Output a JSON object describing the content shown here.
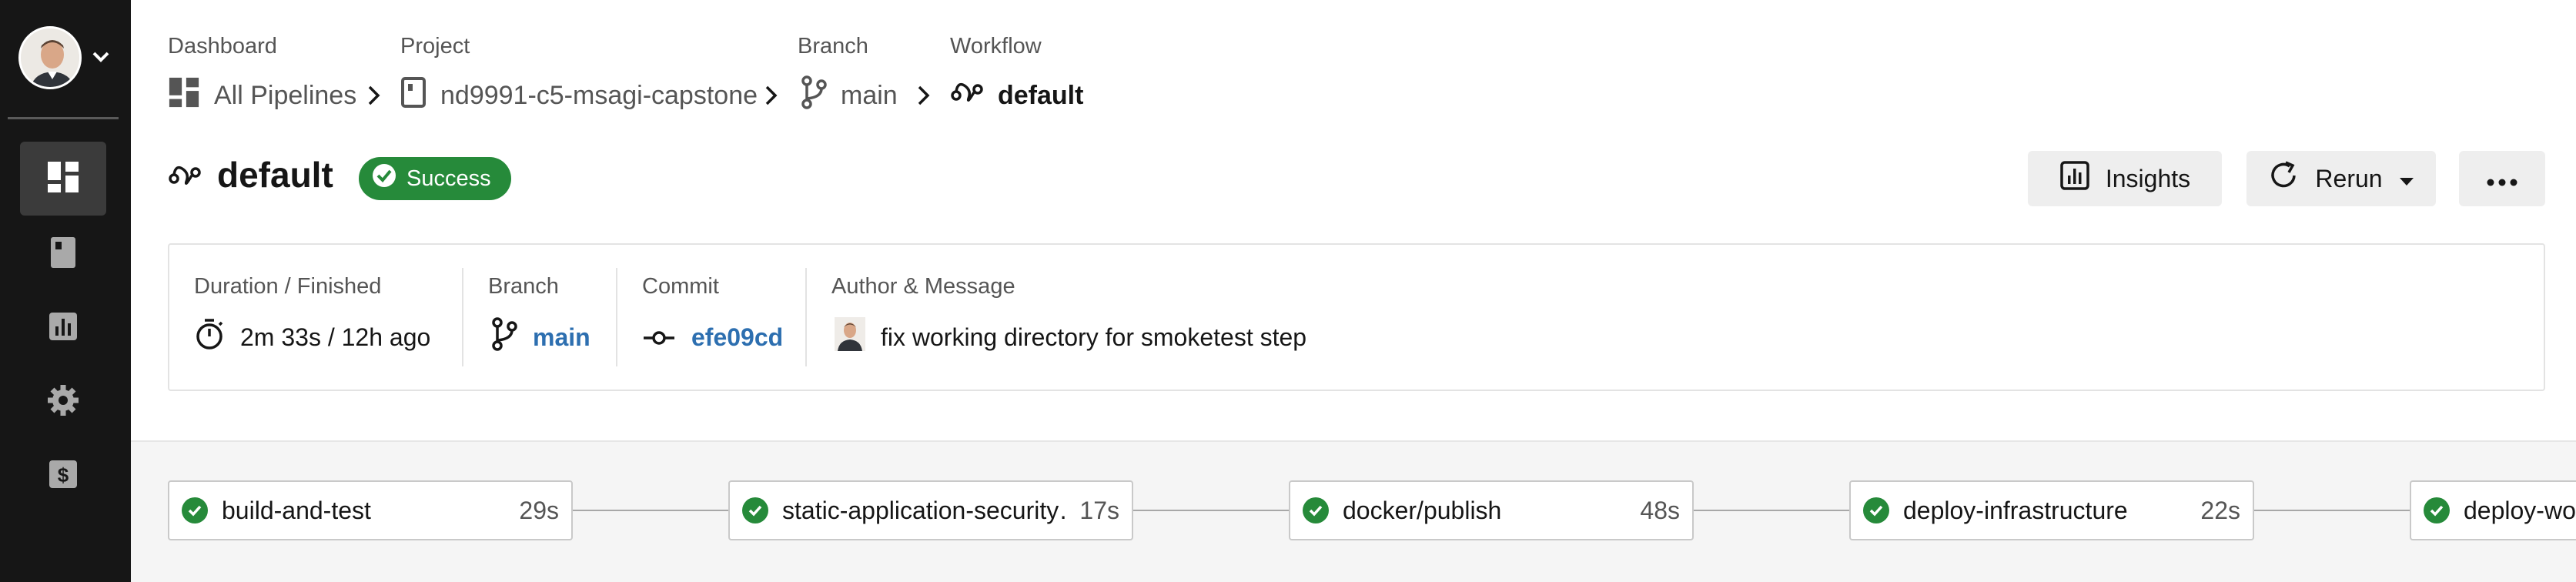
{
  "breadcrumbs": [
    {
      "label": "Dashboard",
      "value": "All Pipelines"
    },
    {
      "label": "Project",
      "value": "nd9991-c5-msagi-capstone"
    },
    {
      "label": "Branch",
      "value": "main"
    },
    {
      "label": "Workflow",
      "value": "default"
    }
  ],
  "workflow": {
    "title": "default",
    "status": "Success"
  },
  "actions": {
    "insights": "Insights",
    "rerun": "Rerun"
  },
  "details": {
    "duration_label": "Duration / Finished",
    "duration_value": "2m 33s / 12h ago",
    "branch_label": "Branch",
    "branch_value": "main",
    "commit_label": "Commit",
    "commit_value": "efe09cd",
    "author_label": "Author & Message",
    "message": "fix working directory for smoketest step"
  },
  "jobs": [
    {
      "name": "build-and-test",
      "duration": "29s"
    },
    {
      "name": "static-application-security…",
      "duration": "17s"
    },
    {
      "name": "docker/publish",
      "duration": "48s"
    },
    {
      "name": "deploy-infrastructure",
      "duration": "22s"
    },
    {
      "name": "deploy-workload",
      "duration": ""
    }
  ],
  "colors": {
    "sidebar": "#161616",
    "success": "#268a3a",
    "link": "#2d6fb0",
    "button": "#eeeeee"
  }
}
